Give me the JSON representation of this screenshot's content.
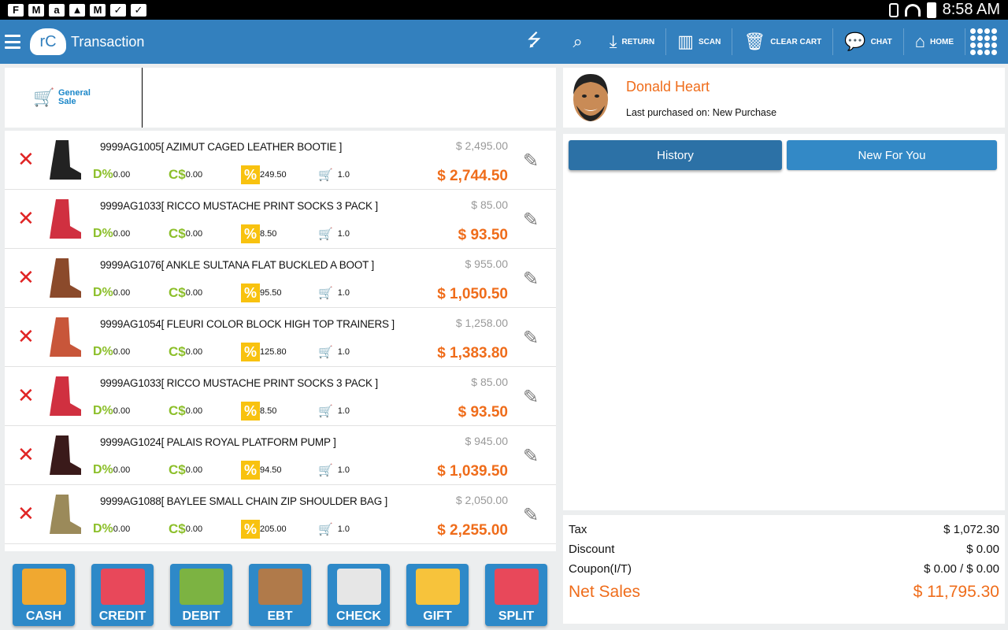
{
  "status_bar": {
    "time": "8:58 AM"
  },
  "header": {
    "title": "Transaction",
    "logo_text": "rC",
    "actions": [
      {
        "label": "RETURN"
      },
      {
        "label": "SCAN"
      },
      {
        "label": "CLEAR CART"
      },
      {
        "label": "CHAT"
      },
      {
        "label": "HOME"
      }
    ]
  },
  "category": {
    "label": "General Sale"
  },
  "items": [
    {
      "name": "9999AG1005[ AZIMUT CAGED LEATHER BOOTIE ]",
      "discount": "0.00",
      "coupon": "0.00",
      "tax": "249.50",
      "qty": "1.0",
      "price": "$ 2,495.00",
      "total": "$ 2,744.50"
    },
    {
      "name": "9999AG1033[ RICCO MUSTACHE PRINT SOCKS 3 PACK ]",
      "discount": "0.00",
      "coupon": "0.00",
      "tax": "8.50",
      "qty": "1.0",
      "price": "$ 85.00",
      "total": "$ 93.50"
    },
    {
      "name": "9999AG1076[ ANKLE SULTANA FLAT BUCKLED A BOOT ]",
      "discount": "0.00",
      "coupon": "0.00",
      "tax": "95.50",
      "qty": "1.0",
      "price": "$ 955.00",
      "total": "$ 1,050.50"
    },
    {
      "name": "9999AG1054[ FLEURI COLOR BLOCK HIGH TOP TRAINERS  ]",
      "discount": "0.00",
      "coupon": "0.00",
      "tax": "125.80",
      "qty": "1.0",
      "price": "$ 1,258.00",
      "total": "$ 1,383.80"
    },
    {
      "name": "9999AG1033[ RICCO MUSTACHE PRINT SOCKS 3 PACK ]",
      "discount": "0.00",
      "coupon": "0.00",
      "tax": "8.50",
      "qty": "1.0",
      "price": "$ 85.00",
      "total": "$ 93.50"
    },
    {
      "name": "9999AG1024[ PALAIS ROYAL PLATFORM PUMP ]",
      "discount": "0.00",
      "coupon": "0.00",
      "tax": "94.50",
      "qty": "1.0",
      "price": "$ 945.00",
      "total": "$ 1,039.50"
    },
    {
      "name": "9999AG1088[ BAYLEE SMALL CHAIN ZIP SHOULDER BAG ]",
      "discount": "0.00",
      "coupon": "0.00",
      "tax": "205.00",
      "qty": "1.0",
      "price": "$ 2,050.00",
      "total": "$ 2,255.00"
    }
  ],
  "payments": [
    {
      "label": "CASH",
      "icon": "money-bag-icon",
      "color": "#f0a830"
    },
    {
      "label": "CREDIT",
      "icon": "credit-card-icon",
      "color": "#e8485a"
    },
    {
      "label": "DEBIT",
      "icon": "debit-card-icon",
      "color": "#7cb342"
    },
    {
      "label": "EBT",
      "icon": "grocery-bag-icon",
      "color": "#b07a4a"
    },
    {
      "label": "CHECK",
      "icon": "check-icon",
      "color": "#e6e6e6"
    },
    {
      "label": "GIFT",
      "icon": "gift-icon",
      "color": "#f7c33b"
    },
    {
      "label": "SPLIT",
      "icon": "split-icon",
      "color": "#e8485a"
    }
  ],
  "customer": {
    "name": "Donald Heart",
    "last_purchased": "Last purchased on: New Purchase"
  },
  "tabs": [
    {
      "label": "History"
    },
    {
      "label": "New For You"
    }
  ],
  "totals": {
    "tax_label": "Tax",
    "tax": "$ 1,072.30",
    "discount_label": "Discount",
    "discount": "$ 0.00",
    "coupon_label": "Coupon(I/T)",
    "coupon": "$ 0.00 / $ 0.00",
    "net_label": "Net Sales",
    "net": "$ 11,795.30"
  },
  "colors": {
    "toolbar": "#3380be",
    "accent": "#ef6c1a",
    "delete": "#e02424"
  }
}
